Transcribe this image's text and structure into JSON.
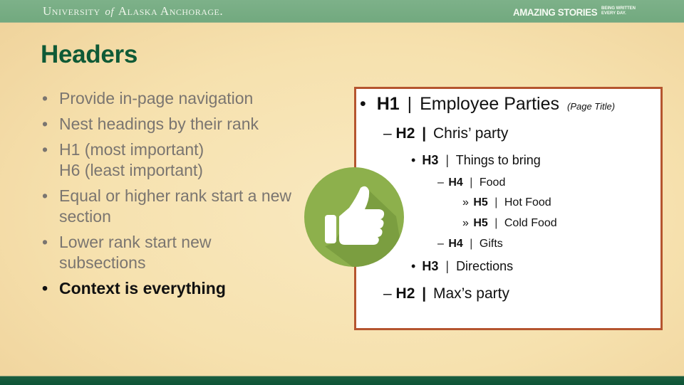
{
  "header": {
    "logo_main": "University",
    "logo_of": "of",
    "logo_rest": "Alaska Anchorage",
    "logo_mark": ".",
    "tagline": "AMAZING STORIES",
    "tagline_small": "BEING WRITTEN EVERY DAY."
  },
  "slide": {
    "title": "Headers",
    "bullets": [
      "Provide in-page navigation",
      "Nest headings by their rank",
      "H1 (most important) H6 (least important)",
      "Equal or higher rank start a new section",
      "Lower rank start new subsections",
      "Context is everything"
    ]
  },
  "outline": {
    "items": [
      {
        "marker": "•",
        "level": "H1",
        "sep": "|",
        "text": "Employee Parties",
        "note": "(Page Title)"
      },
      {
        "marker": "–",
        "level": "H2",
        "sep": "|",
        "text": "Chris’ party"
      },
      {
        "marker": "•",
        "level": "H3",
        "sep": "|",
        "text": "Things to bring"
      },
      {
        "marker": "–",
        "level": "H4",
        "sep": "|",
        "text": "Food"
      },
      {
        "marker": "»",
        "level": "H5",
        "sep": "|",
        "text": "Hot Food"
      },
      {
        "marker": "»",
        "level": "H5",
        "sep": "|",
        "text": "Cold Food"
      },
      {
        "marker": "–",
        "level": "H4",
        "sep": "|",
        "text": "Gifts"
      },
      {
        "marker": "•",
        "level": "H3",
        "sep": "|",
        "text": "Directions"
      },
      {
        "marker": "–",
        "level": "H2",
        "sep": "|",
        "text": "Max’s party"
      }
    ]
  },
  "icons": {
    "thumb": "thumbs-up-icon"
  },
  "colors": {
    "title_green": "#0f5a36",
    "header_bar": "#75ab82",
    "box_border": "#b5552f",
    "thumb_circle": "#8db04c"
  }
}
